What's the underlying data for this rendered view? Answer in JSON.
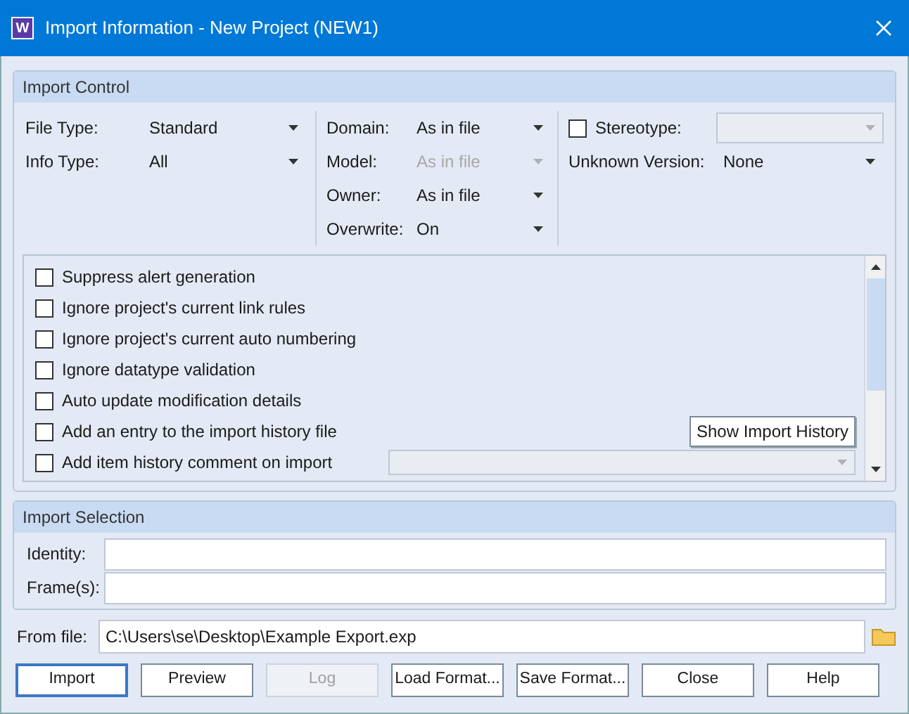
{
  "window": {
    "title": "Import Information - New Project (NEW1)",
    "logo": "W"
  },
  "import_control": {
    "title": "Import Control",
    "column_1": [
      {
        "label": "File Type:",
        "value": "Standard",
        "disabled": false
      },
      {
        "label": "Info Type:",
        "value": "All",
        "disabled": false
      }
    ],
    "column_2": [
      {
        "label": "Domain:",
        "value": "As in file",
        "disabled": false
      },
      {
        "label": "Model:",
        "value": "As in file",
        "disabled": true
      },
      {
        "label": "Owner:",
        "value": "As in file",
        "disabled": false
      },
      {
        "label": "Overwrite:",
        "value": "On",
        "disabled": false
      }
    ],
    "stereotype": {
      "label": "Stereotype:",
      "checked": false
    },
    "unknown_version": {
      "label": "Unknown Version:",
      "value": "None"
    },
    "options": [
      {
        "label": "Suppress alert generation",
        "checked": false
      },
      {
        "label": "Ignore project's current link rules",
        "checked": false
      },
      {
        "label": "Ignore project's current auto numbering",
        "checked": false
      },
      {
        "label": "Ignore datatype validation",
        "checked": false
      },
      {
        "label": "Auto update modification details",
        "checked": false
      },
      {
        "label": "Add an entry to the import history file",
        "checked": false,
        "button": "Show Import History"
      },
      {
        "label": "Add item history comment on import",
        "checked": false,
        "combo": true
      }
    ]
  },
  "import_selection": {
    "title": "Import Selection",
    "fields": [
      {
        "label": "Identity:"
      },
      {
        "label": "Frame(s):"
      }
    ]
  },
  "from_file": {
    "label": "From file:",
    "value": "C:\\Users\\se\\Desktop\\Example Export.exp"
  },
  "buttons": [
    {
      "label": "Import",
      "disabled": false,
      "focused": true
    },
    {
      "label": "Preview",
      "disabled": false,
      "focused": false
    },
    {
      "label": "Log",
      "disabled": true,
      "focused": false
    },
    {
      "label": "Load Format...",
      "disabled": false,
      "focused": false
    },
    {
      "label": "Save Format...",
      "disabled": false,
      "focused": false
    },
    {
      "label": "Close",
      "disabled": false,
      "focused": false
    },
    {
      "label": "Help",
      "disabled": false,
      "focused": false
    }
  ]
}
